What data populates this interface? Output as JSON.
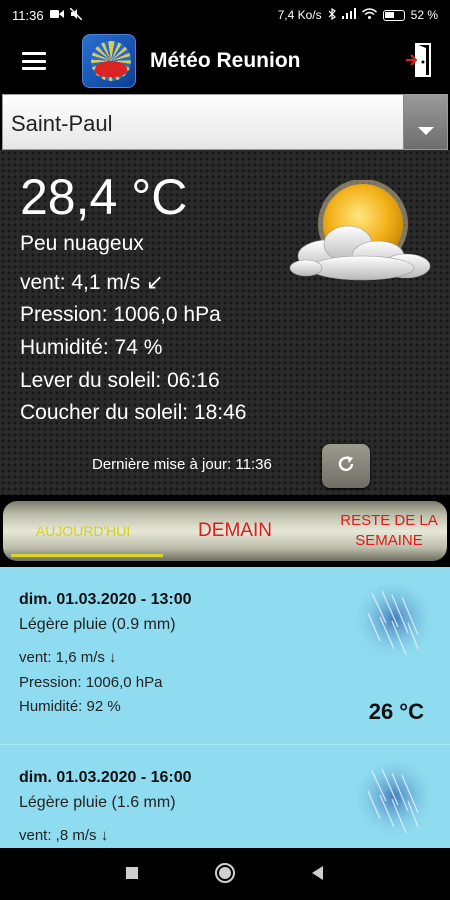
{
  "status_bar": {
    "time": "11:36",
    "network_speed": "7,4 Ko/s",
    "battery": "52 %",
    "icons": [
      "video-icon",
      "mute-icon",
      "bluetooth-icon",
      "signal-icon",
      "wifi-icon",
      "battery-icon"
    ]
  },
  "app_bar": {
    "title": "Météo Reunion",
    "icons": [
      "menu-icon",
      "app-logo",
      "exit-door-icon"
    ]
  },
  "location_select": {
    "selected": "Saint-Paul"
  },
  "current": {
    "temperature": "28,4 °C",
    "condition": "Peu nuageux",
    "wind": "vent: 4,1 m/s ↙",
    "pressure": "Pression: 1006,0 hPa",
    "humidity": "Humidité: 74 %",
    "sunrise": "Lever du soleil: 06:16",
    "sunset": "Coucher du soleil: 18:46",
    "last_update": "Dernière mise à jour: 11:36",
    "icon": "partly-cloudy-sun-icon"
  },
  "tabs": {
    "today": "AUJOURD'HUI",
    "tomorrow": "DEMAIN",
    "rest_line1": "RESTE DE LA",
    "rest_line2": "SEMAINE",
    "active": "today"
  },
  "forecast": [
    {
      "datetime": "dim. 01.03.2020 - 13:00",
      "description": "Légère pluie (0.9 mm)",
      "wind": "vent: 1,6 m/s ↓",
      "pressure": "Pression: 1006,0 hPa",
      "humidity": "Humidité: 92 %",
      "temperature": "26 °C",
      "icon": "rain-icon"
    },
    {
      "datetime": "dim. 01.03.2020 - 16:00",
      "description": "Légère pluie (1.6 mm)",
      "wind": "vent: ,8 m/s ↓",
      "icon": "rain-icon"
    }
  ],
  "colors": {
    "forecast_bg": "#8fdcf0",
    "tab_active": "#d4cf22",
    "tab_inactive": "#e01b1b"
  }
}
